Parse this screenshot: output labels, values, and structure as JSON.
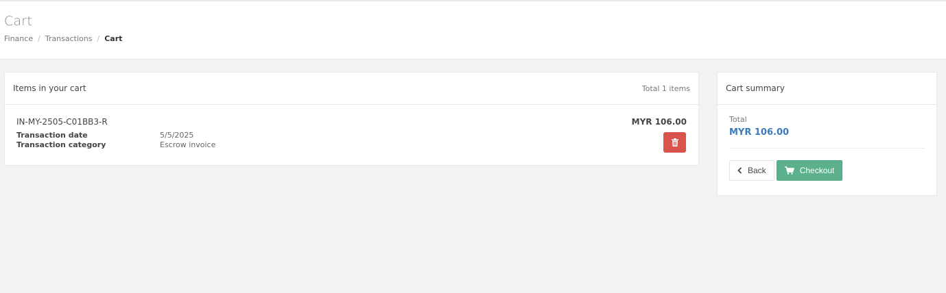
{
  "header": {
    "title": "Cart",
    "breadcrumb": [
      "Finance",
      "Transactions",
      "Cart"
    ],
    "breadcrumb_separator": "/"
  },
  "cart": {
    "heading": "Items in your cart",
    "total_items_text": "Total 1 items",
    "items": [
      {
        "id": "IN-MY-2505-C01BB3-R",
        "price": "MYR 106.00",
        "fields": [
          {
            "label": "Transaction date",
            "value": "5/5/2025"
          },
          {
            "label": "Transaction category",
            "value": "Escrow invoice"
          }
        ],
        "delete_icon": "trash-icon"
      }
    ]
  },
  "summary": {
    "heading": "Cart summary",
    "total_label": "Total",
    "total_value": "MYR 106.00",
    "back_label": "Back",
    "checkout_label": "Checkout",
    "back_icon": "chevron-left-icon",
    "checkout_icon": "shopping-cart-icon"
  },
  "colors": {
    "delete": "#d9534f",
    "checkout": "#5cb08c",
    "total": "#3a7bc0",
    "background": "#f2f2f2"
  }
}
